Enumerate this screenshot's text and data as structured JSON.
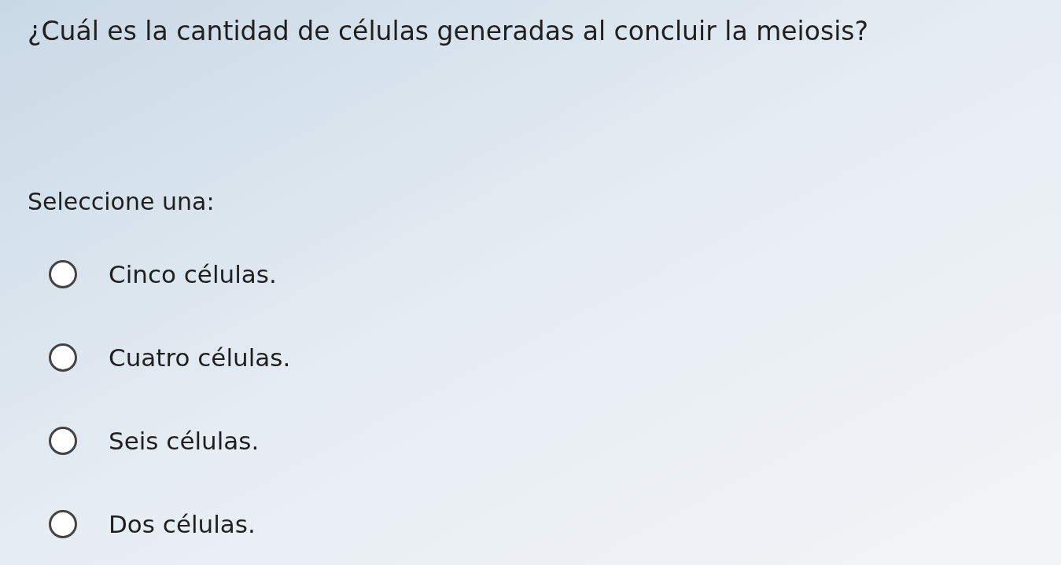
{
  "question": "¿Cuál es la cantidad de células generadas al concluir la meiosis?",
  "prompt": "Seleccione una:",
  "options": [
    {
      "label": "Cinco células.",
      "selected": false
    },
    {
      "label": "Cuatro células.",
      "selected": false
    },
    {
      "label": "Seis células.",
      "selected": false
    },
    {
      "label": "Dos células.",
      "selected": false
    }
  ]
}
